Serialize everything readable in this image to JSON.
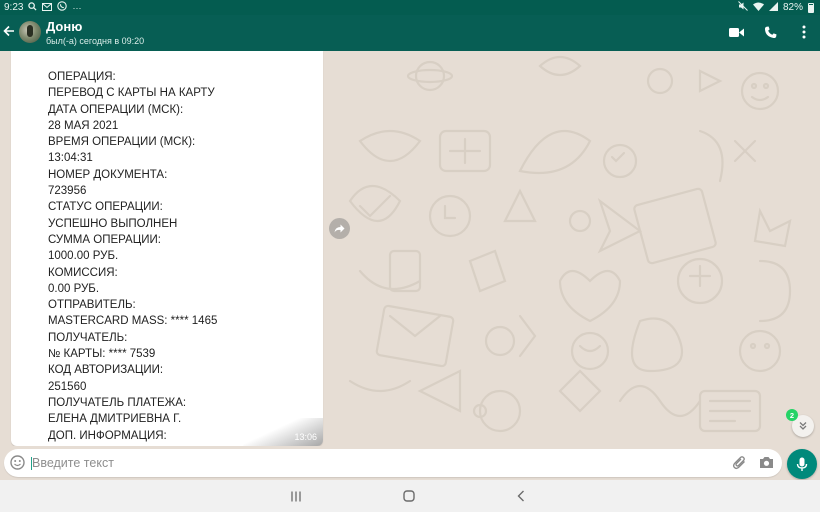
{
  "status_bar": {
    "time": "9:23",
    "left_icons": [
      "search-icon",
      "mail-icon",
      "viber-icon",
      "more-dots-icon"
    ],
    "right_icons": [
      "mute-icon",
      "wifi-icon",
      "signal-icon",
      "battery-icon"
    ],
    "battery": "82%"
  },
  "header": {
    "contact_name": "Доню",
    "contact_status": "был(-а) сегодня в 09:20",
    "icons": [
      "video-call-icon",
      "voice-call-icon",
      "overflow-menu-icon"
    ],
    "color": "#075e54"
  },
  "message": {
    "lines": [
      "ОПЕРАЦИЯ:",
      "ПЕРЕВОД С КАРТЫ НА КАРТУ",
      "ДАТА ОПЕРАЦИИ (МСК):",
      "28 МАЯ 2021",
      "ВРЕМЯ ОПЕРАЦИИ (МСК):",
      "13:04:31",
      "НОМЕР ДОКУМЕНТА:",
      "723956",
      "СТАТУС ОПЕРАЦИИ:",
      "УСПЕШНО ВЫПОЛНЕН",
      "СУММА ОПЕРАЦИИ:",
      "1000.00 РУБ.",
      "КОМИССИЯ:",
      "0.00 РУБ.",
      "ОТПРАВИТЕЛЬ:",
      "MASTERCARD MASS: **** 1465",
      "ПОЛУЧАТЕЛЬ:",
      "№ КАРТЫ: **** 7539",
      "КОД АВТОРИЗАЦИИ:",
      "251560",
      "ПОЛУЧАТЕЛЬ ПЛАТЕЖА:",
      "ЕЛЕНА ДМИТРИЕВНА Г.",
      "ДОП. ИНФОРМАЦИЯ:"
    ],
    "time": "13:06"
  },
  "scroll_down": {
    "unread_count": "2"
  },
  "composer": {
    "placeholder": "Введите текст",
    "value": "",
    "icons": [
      "emoji-icon",
      "attach-icon",
      "camera-icon",
      "mic-icon"
    ],
    "accent": "#00897b"
  },
  "navbar": {
    "icons": [
      "recent-apps-icon",
      "home-icon",
      "back-icon"
    ]
  }
}
